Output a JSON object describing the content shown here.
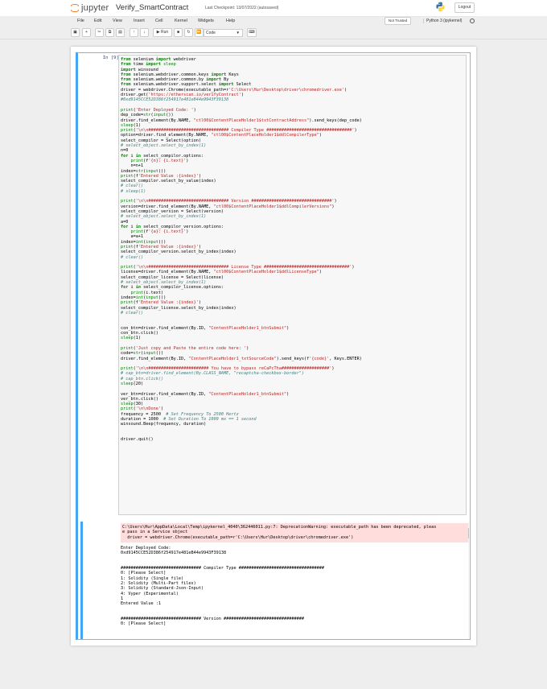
{
  "header": {
    "logo_text": "jupyter",
    "notebook_name": "Verify_SmartContract",
    "checkpoint": "Last Checkpoint: 13/07/2022",
    "autosave": "(autosaved)",
    "logout_label": "Logout"
  },
  "menubar": {
    "items": [
      "File",
      "Edit",
      "View",
      "Insert",
      "Cell",
      "Kernel",
      "Widgets",
      "Help"
    ],
    "trust_label": "Not Trusted",
    "kernel_name": "Python 3 (ipykernel)"
  },
  "toolbar": {
    "run_label": "Run",
    "cell_type": "Code"
  },
  "cell": {
    "prompt": "In [9]:"
  },
  "code_lines": [
    "from selenium import webdriver",
    "from time import sleep",
    "import winsound",
    "from selenium.webdriver.common.keys import Keys",
    "from selenium.webdriver.common.by import By",
    "from selenium.webdriver.support.select import Select",
    "driver = webdriver.Chrome(executable_path=r'C:\\Users\\Hur\\Desktop\\driver\\chromedriver.exe')",
    "driver.get('https://etherscan.io/verifyContract')",
    "#0xd9145CCE52D386f254917e481eB44e9943F39138",
    "",
    "print('Enter Deployed Code: ')",
    "dep_code=str(input())",
    "driver.find_element(By.NAME, \"ctl00$ContentPlaceHolder1$txtContractAddress\").send_keys(dep_code)",
    "sleep(1)",
    "print('\\n\\n################################ Compiler Type ##################################')",
    "option=driver.find_element(By.NAME, \"ctl00$ContentPlaceHolder1$ddlCompilerType\")",
    "select_compilor = Select(option)",
    "# select_object.select_by_index(1)",
    "n=0",
    "for i in select_compilor.options:",
    "    print(f'{n}: {i.text}')",
    "    n=n+1",
    "index=str(input())",
    "print(f'Entered Value :{index}')",
    "select_compilor.select_by_value(index)",
    "# clear()",
    "# sleep(1)",
    "",
    "print('\\n\\n################################ Version ################################')",
    "version=driver.find_element(By.NAME, \"ctl00$ContentPlaceHolder1$ddlCompilerVersions\")",
    "select_compilor_version = Select(version)",
    "# select_object.select_by_index(1)",
    "a=0",
    "for i in select_compilor_version.options:",
    "    print(f'{a}: {i.text}')",
    "    a=a+1",
    "index=int(input())",
    "print(f'Entered Value :{index}')",
    "select_compilor_version.select_by_index(index)",
    "# clear()",
    "",
    "print('\\n\\n################################ License Type ##################################')",
    "license=driver.find_element(By.NAME, \"ctl00$ContentPlaceHolder1$ddlLicenseType\")",
    "select_compilor_license = Select(license)",
    "# select_object.select_by_index(1)",
    "for i in select_compilor_license.options:",
    "    print(i.text)",
    "index=int(input())",
    "print(f'Entered Value :{index}')",
    "select_compilor_license.select_by_index(index)",
    "# clear()",
    "",
    "",
    "con_btn=driver.find_element(By.ID, \"ContentPlaceHolder1_btnSubmit\")",
    "con_btn.click()",
    "sleep(1)",
    "",
    "print('Just copy and Paste the entire code here: ')",
    "code=str(input())",
    "driver.find_element(By.ID, \"ContentPlaceHolder1_txtSourceCode\").send_keys(f'{code}', Keys.ENTER)",
    "",
    "print('\\n\\n######################## You have to bypass reCaPcTha###################')",
    "# cap_btn=driver.find_element(By.CLASS_NAME, \"recaptcha-checkbox-border\")",
    "# cap_btn.click()",
    "sleep(20)",
    "",
    "ver_btn=driver.find_element(By.ID, \"ContentPlaceHolder1_btnSubmit\")",
    "ver_btn.click()",
    "sleep(30)",
    "print('\\n\\nDone')",
    "frequency = 2500  # Set Frequency To 2500 Hertz",
    "duration = 1000  # Set Duration To 1000 ms == 1 second",
    "winsound.Beep(frequency, duration)",
    "",
    "",
    "driver.quit()"
  ],
  "stderr_lines": [
    "C:\\Users\\Hur\\AppData\\Local\\Temp\\ipykernel_4040\\362446011.py:7: DeprecationWarning: executable_path has been deprecated, pleas",
    "e pass in a Service object",
    "  driver = webdriver.Chrome(executable_path=r'C:\\Users\\Hur\\Desktop\\driver\\chromedriver.exe')"
  ],
  "stdout_lines": [
    "Enter Deployed Code:",
    "0xd9145CCE52D386f254917e481eB44e9943F39138",
    "",
    "",
    "################################ Compiler Type ##################################",
    "0: [Please Select]",
    "1: Solidity (Single file)",
    "2: Solidity (Multi-Part files)",
    "3: Solidity (Standard-Json-Input)",
    "4: Vyper (Experimental)",
    "1",
    "Entered Value :1",
    "",
    "",
    "################################ Version ################################",
    "0: [Please Select]"
  ],
  "colors": {
    "accent": "#42a5f5",
    "stderr_bg": "#ffdddd",
    "logo_orange": "#f37726"
  }
}
